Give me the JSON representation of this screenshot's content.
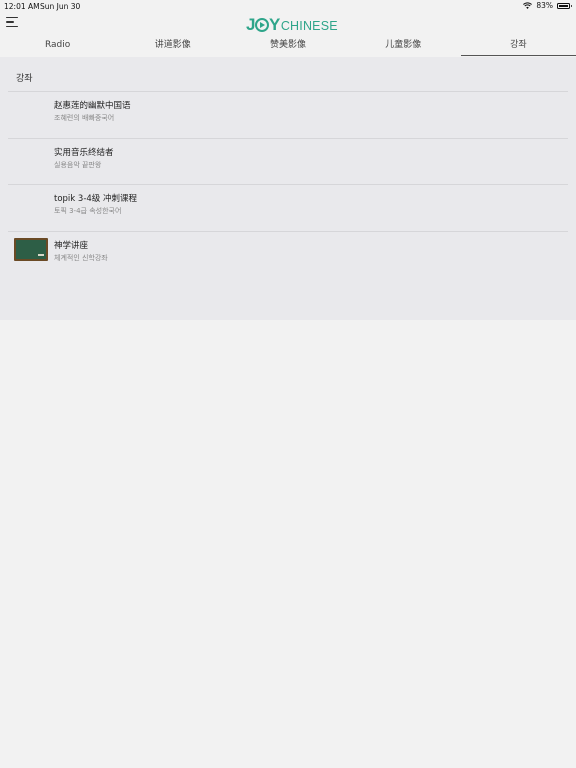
{
  "status_bar": {
    "time": "12:01 AM",
    "date": "Sun Jun 30",
    "battery": "83%",
    "battery_level": 0.83
  },
  "header": {
    "logo_joy_prefix": "J",
    "logo_joy_suffix": "Y",
    "logo_chinese": "CHINESE",
    "brand_color": "#2ea58a"
  },
  "tabs": [
    {
      "label": "Radio",
      "active": false
    },
    {
      "label": "讲道影像",
      "active": false
    },
    {
      "label": "赞美影像",
      "active": false
    },
    {
      "label": "儿童影像",
      "active": false
    },
    {
      "label": "강좌",
      "active": true
    }
  ],
  "section": {
    "title": "강좌"
  },
  "items": [
    {
      "title": "赵惠莲的幽默中国语",
      "subtitle": "조혜련의 배빠중국어",
      "has_thumbnail": false
    },
    {
      "title": "实用音乐终结者",
      "subtitle": "실용음악 끝판왕",
      "has_thumbnail": false
    },
    {
      "title": "topik 3-4级 冲刺课程",
      "subtitle": "토픽 3-4급 속성한국어",
      "has_thumbnail": false
    },
    {
      "title": "神学讲座",
      "subtitle": "체계적인 신학강좌",
      "has_thumbnail": true,
      "thumbnail_icon": "chalkboard-icon"
    }
  ]
}
